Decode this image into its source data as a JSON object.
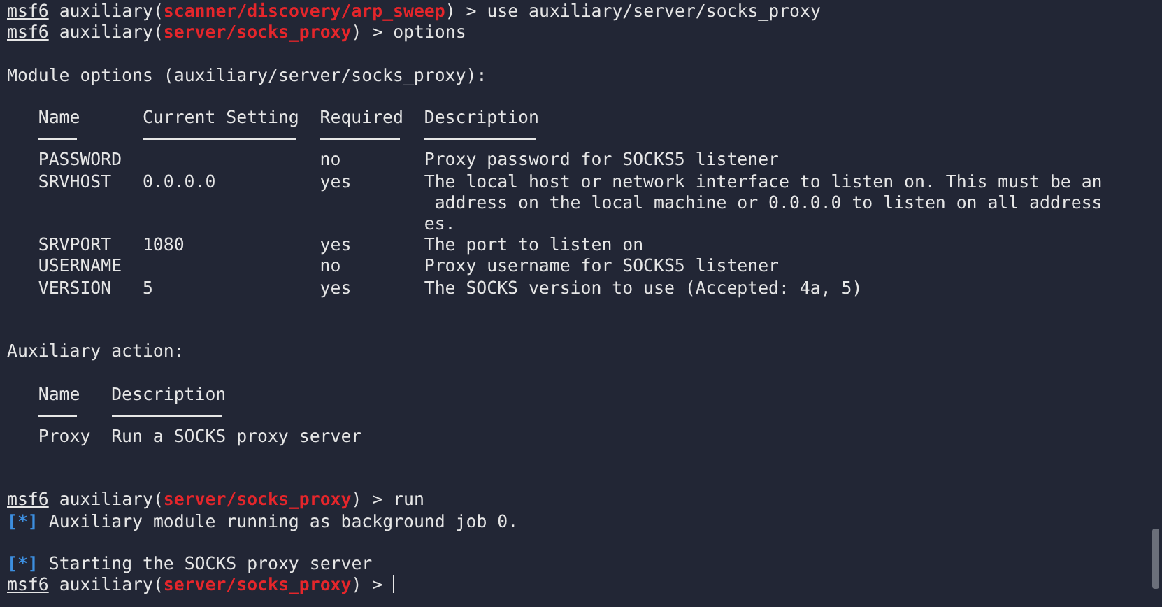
{
  "lines": [
    {
      "kind": "prompt",
      "user": "msf6",
      "prefix": "auxiliary(",
      "module": "scanner/discovery/arp_sweep",
      "suffix": ") >",
      "command": "use auxiliary/server/socks_proxy",
      "cursor": false
    },
    {
      "kind": "prompt",
      "user": "msf6",
      "prefix": "auxiliary(",
      "module": "server/socks_proxy",
      "suffix": ") >",
      "command": "options",
      "cursor": false
    },
    {
      "kind": "blank"
    },
    {
      "kind": "text",
      "text": "Module options (auxiliary/server/socks_proxy):"
    },
    {
      "kind": "blank"
    },
    {
      "kind": "table",
      "columns": [
        "Name",
        "Current Setting",
        "Required",
        "Description"
      ],
      "rows": [
        {
          "name": "PASSWORD",
          "required": "no",
          "description": "Proxy password for SOCKS5 listener"
        },
        {
          "name": "SRVHOST",
          "current_setting": "0.0.0.0",
          "required": "yes",
          "description": "The local host or network interface to listen on. This must be an\n address on the local machine or 0.0.0.0 to listen on all address\nes."
        },
        {
          "name": "SRVPORT",
          "current_setting": "1080",
          "required": "yes",
          "description": "The port to listen on"
        },
        {
          "name": "USERNAME",
          "required": "no",
          "description": "Proxy username for SOCKS5 listener"
        },
        {
          "name": "VERSION",
          "current_setting": "5",
          "required": "yes",
          "description": "The SOCKS version to use (Accepted: 4a, 5)"
        }
      ]
    },
    {
      "kind": "blank"
    },
    {
      "kind": "blank"
    },
    {
      "kind": "text",
      "text": "Auxiliary action:"
    },
    {
      "kind": "blank"
    },
    {
      "kind": "table",
      "columns": [
        "Name",
        "Description"
      ],
      "rows": [
        {
          "name": "Proxy",
          "description": "Run a SOCKS proxy server"
        }
      ]
    },
    {
      "kind": "blank"
    },
    {
      "kind": "blank"
    },
    {
      "kind": "prompt",
      "user": "msf6",
      "prefix": "auxiliary(",
      "module": "server/socks_proxy",
      "suffix": ") >",
      "command": "run",
      "cursor": false
    },
    {
      "kind": "info",
      "marker": "[*]",
      "text": "Auxiliary module running as background job 0."
    },
    {
      "kind": "blank"
    },
    {
      "kind": "info",
      "marker": "[*]",
      "text": "Starting the SOCKS proxy server"
    },
    {
      "kind": "prompt",
      "user": "msf6",
      "prefix": "auxiliary(",
      "module": "server/socks_proxy",
      "suffix": ") >",
      "cursor": true
    }
  ]
}
